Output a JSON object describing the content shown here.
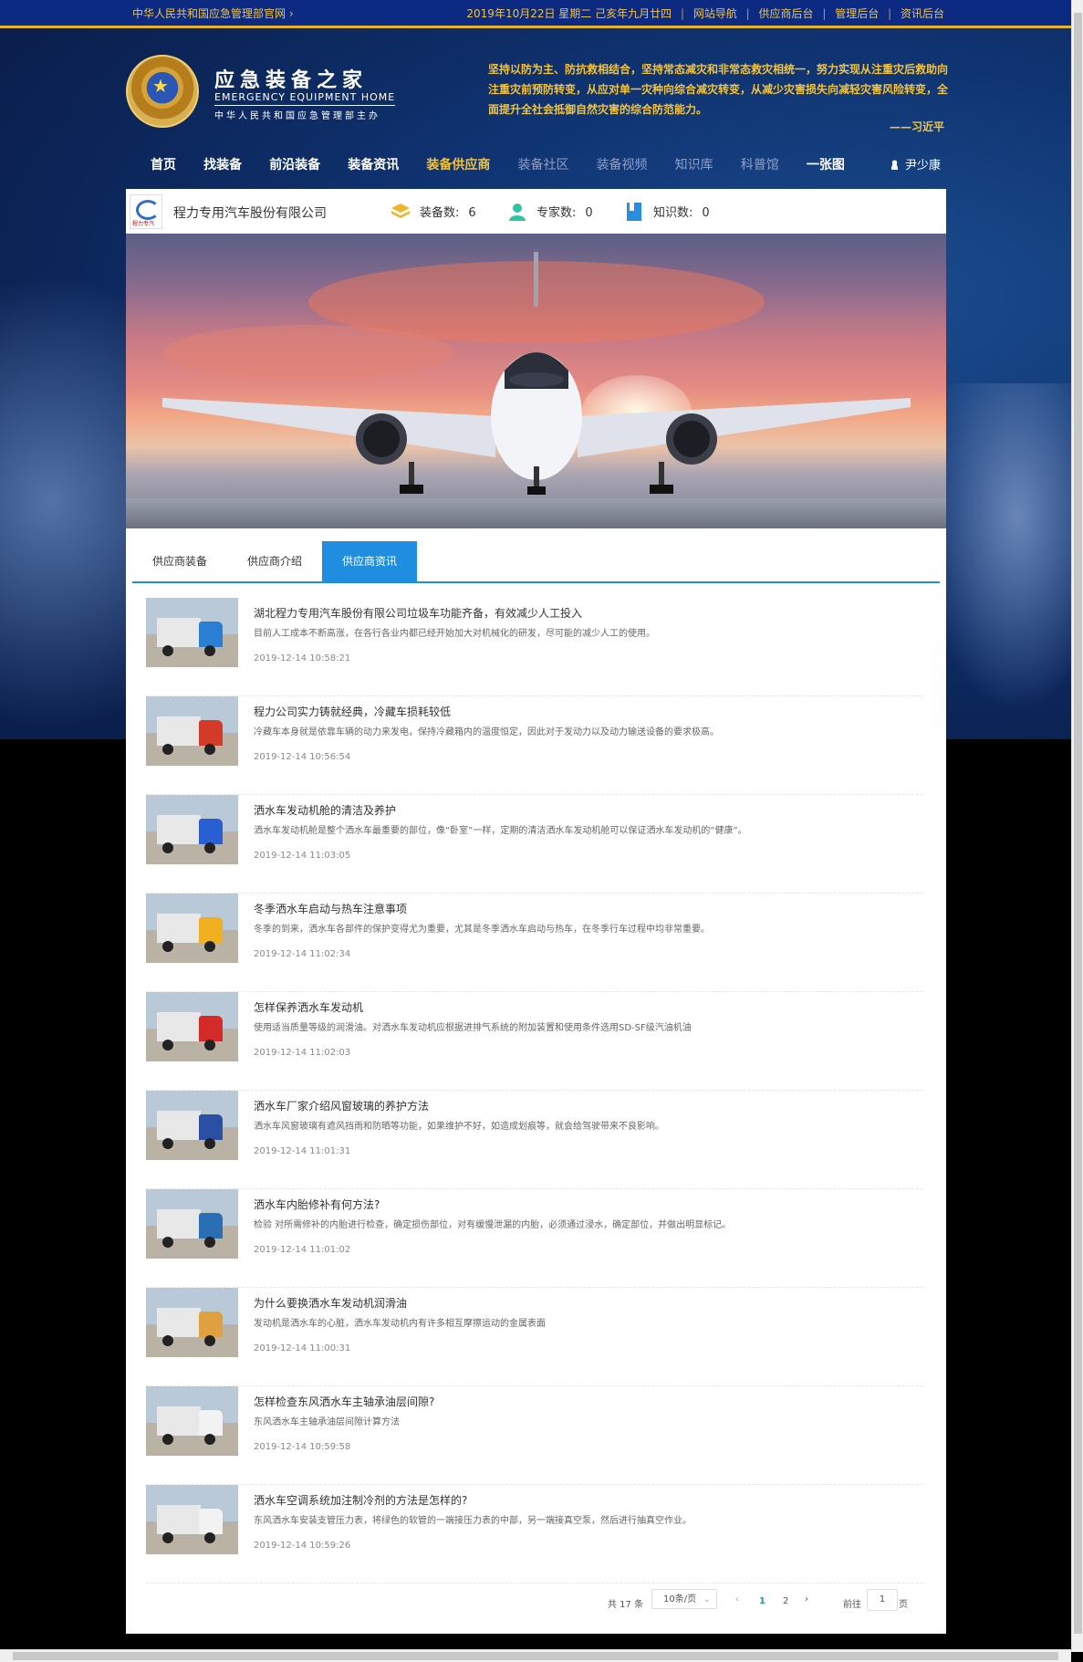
{
  "topbar": {
    "home_link": "中华人民共和国应急管理部官网 ›",
    "date_text": "2019年10月22日 星期二 己亥年九月廿四",
    "links": [
      "网站导航",
      "供应商后台",
      "管理后台",
      "资讯后台"
    ]
  },
  "logo": {
    "title_cn": "应急装备之家",
    "title_en": "EMERGENCY EQUIPMENT HOME",
    "subtitle": "中华人民共和国应急管理部主办"
  },
  "quote": {
    "text": "坚持以防为主、防抗救相结合，坚持常态减灾和非常态救灾相统一，努力实现从注重灾后救助向注重灾前预防转变，从应对单一灾种向综合减灾转变，从减少灾害损失向减轻灾害风险转变，全面提升全社会抵御自然灾害的综合防范能力。",
    "author": "——习近平"
  },
  "nav": {
    "items": [
      "首页",
      "找装备",
      "前沿装备",
      "装备资讯",
      "装备供应商",
      "装备社区",
      "装备视频",
      "知识库",
      "科普馆",
      "一张图"
    ],
    "active_index": 4,
    "user_name": "尹少康"
  },
  "company": {
    "name": "程力专用汽车股份有限公司",
    "logo_text": "程力专汽",
    "stats": [
      {
        "label": "装备数:",
        "value": "6",
        "icon": "stack-icon",
        "color": "#f0b62a"
      },
      {
        "label": "专家数:",
        "value": "0",
        "icon": "person-icon",
        "color": "#2fc4a2"
      },
      {
        "label": "知识数:",
        "value": "0",
        "icon": "book-icon",
        "color": "#2a8ee0"
      }
    ]
  },
  "tabs": [
    "供应商装备",
    "供应商介绍",
    "供应商资讯"
  ],
  "active_tab": 2,
  "articles": [
    {
      "title": "湖北程力专用汽车股份有限公司垃圾车功能齐备，有效减少人工投入",
      "desc": "目前人工成本不断高涨，在各行各业内都已经开始加大对机械化的研发，尽可能的减少人工的使用。",
      "date": "2019-12-14 10:58:21"
    },
    {
      "title": "程力公司实力铸就经典，冷藏车损耗较低",
      "desc": "冷藏车本身就是依靠车辆的动力来发电，保持冷藏箱内的温度恒定，因此对于发动力以及动力输送设备的要求极高。",
      "date": "2019-12-14 10:56:54"
    },
    {
      "title": "洒水车发动机舱的清洁及养护",
      "desc": "洒水车发动机舱是整个洒水车最重要的部位，像“卧室”一样，定期的清洁洒水车发动机舱可以保证洒水车发动机的“健康”。",
      "date": "2019-12-14 11:03:05"
    },
    {
      "title": "冬季洒水车启动与热车注意事项",
      "desc": "冬季的到来，洒水车各部件的保护变得尤为重要，尤其是冬季洒水车启动与热车，在冬季行车过程中均非常重要。",
      "date": "2019-12-14 11:02:34"
    },
    {
      "title": "怎样保养洒水车发动机",
      "desc": "使用适当质量等级的润滑油。对洒水车发动机应根据进排气系统的附加装置和使用条件选用SD-SF级汽油机油",
      "date": "2019-12-14 11:02:03"
    },
    {
      "title": "洒水车厂家介绍风窗玻璃的养护方法",
      "desc": "洒水车风窗玻璃有遮风挡雨和防晒等功能，如果维护不好，如造成划痕等，就会给驾驶带来不良影响。",
      "date": "2019-12-14 11:01:31"
    },
    {
      "title": "洒水车内胎修补有何方法?",
      "desc": "检验 对所需修补的内胎进行检查，确定损伤部位，对有缓慢泄漏的内胎，必须通过浸水，确定部位，并做出明显标记。",
      "date": "2019-12-14 11:01:02"
    },
    {
      "title": "为什么要换洒水车发动机润滑油",
      "desc": "发动机是洒水车的心脏，洒水车发动机内有许多相互摩擦运动的金属表面",
      "date": "2019-12-14 11:00:31"
    },
    {
      "title": "怎样检查东风洒水车主轴承油层间隙?",
      "desc": "东风洒水车主轴承油层间隙计算方法",
      "date": "2019-12-14 10:59:58"
    },
    {
      "title": "洒水车空调系统加注制冷剂的方法是怎样的?",
      "desc": "东风洒水车安装支管压力表，将绿色的软管的一端接压力表的中部，另一端接真空泵，然后进行抽真空作业。",
      "date": "2019-12-14 10:59:26"
    }
  ],
  "thumb_colors": [
    "#2a7fd4",
    "#d43a2a",
    "#2a5fd4",
    "#f0b020",
    "#d42a2a",
    "#2a4fa4",
    "#2a6fb4",
    "#e0a040",
    "#f2f2f2",
    "#f2f2f2"
  ],
  "pagination": {
    "total": "共 17 条",
    "page_size": "10条/页",
    "pages": [
      "1",
      "2"
    ],
    "current": "1",
    "goto_label": "前往",
    "goto_value": "1",
    "page_suffix": "页"
  }
}
